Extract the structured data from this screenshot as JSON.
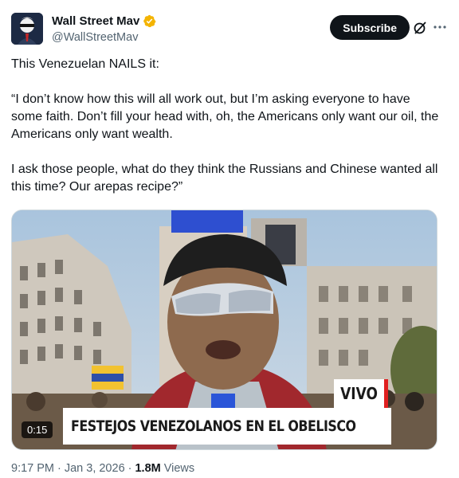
{
  "author": {
    "display_name": "Wall Street Mav",
    "handle": "@WallStreetMav",
    "verified": true,
    "verified_color": "#f4b400"
  },
  "actions": {
    "subscribe_label": "Subscribe",
    "grok_icon": "grok-icon",
    "more_icon": "more-icon"
  },
  "tweet": {
    "paragraphs": [
      "This Venezuelan NAILS it:",
      "“I don’t know how this will all work out, but I’m asking everyone to have some faith. Don’t fill your head with, oh, the Americans only want our oil, the Americans only want wealth.",
      "I ask those people, what do they think the Russians and Chinese wanted all this time? Our arepas recipe?”"
    ]
  },
  "media": {
    "type": "video",
    "duration": "0:15",
    "badge": "VIVO",
    "caption": "FESTEJOS VENEZOLANOS EN EL OBELISCO",
    "badge_accent": "#e02020"
  },
  "meta": {
    "time": "9:17 PM",
    "separator": "·",
    "date": "Jan 3, 2026",
    "views_count": "1.8M",
    "views_label": "Views"
  }
}
